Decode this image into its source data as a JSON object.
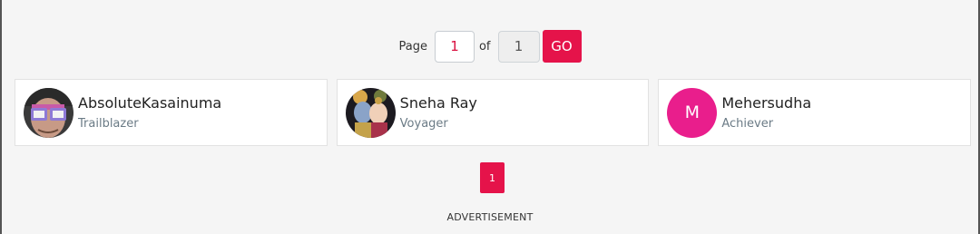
{
  "pager": {
    "page_label": "Page",
    "current_page": "1",
    "of_label": "of",
    "total_pages": "1",
    "go_label": "GO"
  },
  "users": [
    {
      "name": "AbsoluteKasainuma",
      "rank": "Trailblazer",
      "avatar": "photo-man-sunglasses"
    },
    {
      "name": "Sneha Ray",
      "rank": "Voyager",
      "avatar": "photo-couple-illustration"
    },
    {
      "name": "Mehersudha",
      "rank": "Achiever",
      "avatar_letter": "M",
      "avatar_color": "#e91e8c"
    }
  ],
  "pagination": {
    "page_1": "1"
  },
  "advertisement_label": "ADVERTISEMENT",
  "colors": {
    "accent": "#e5134a",
    "background": "#f5f5f5",
    "rank_text": "#6b7b86"
  }
}
